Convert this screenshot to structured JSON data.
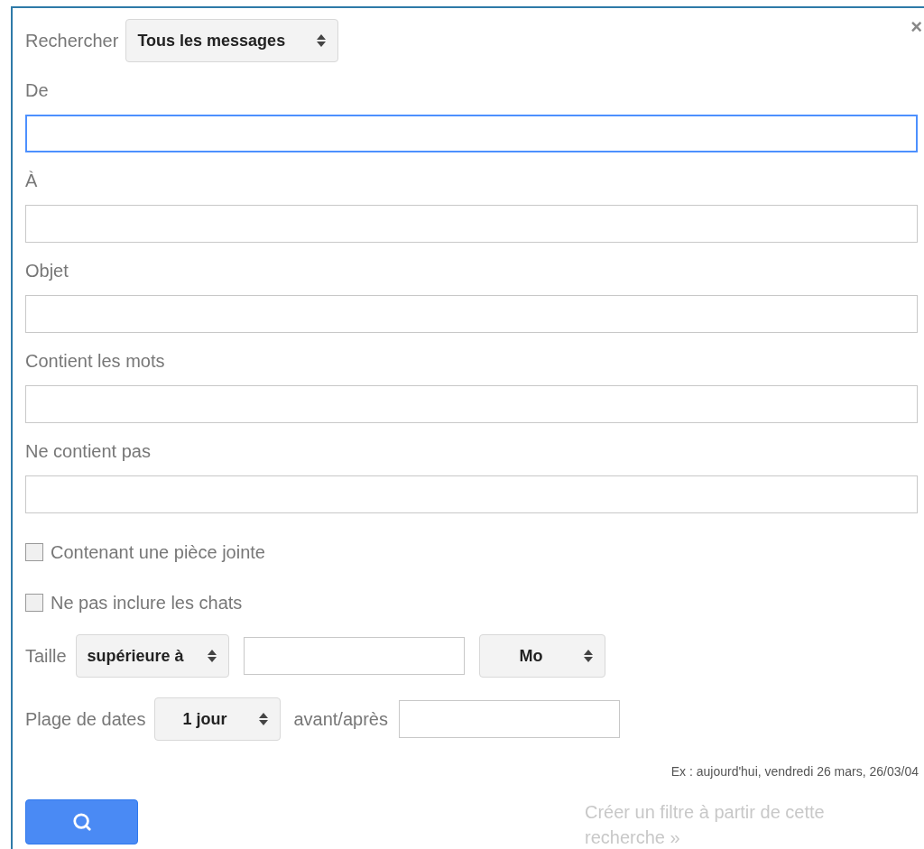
{
  "header": {
    "label": "Rechercher",
    "scope": "Tous les messages",
    "close": "×"
  },
  "fields": [
    {
      "label": "De",
      "focused": true
    },
    {
      "label": "À",
      "focused": false
    },
    {
      "label": "Objet",
      "focused": false
    },
    {
      "label": "Contient les mots",
      "focused": false
    },
    {
      "label": "Ne contient pas",
      "focused": false
    }
  ],
  "checkboxes": [
    {
      "label": "Contenant une pièce jointe",
      "checked": false
    },
    {
      "label": "Ne pas inclure les chats",
      "checked": false
    }
  ],
  "size": {
    "label": "Taille",
    "comparator": "supérieure à",
    "unit": "Mo"
  },
  "dates": {
    "label": "Plage de dates",
    "range": "1 jour",
    "relation": "avant/après",
    "hint": "Ex : aujourd'hui, vendredi 26 mars, 26/03/04"
  },
  "filter_link": {
    "text": "Créer un filtre à partir de cette recherche »",
    "disabled": true
  }
}
